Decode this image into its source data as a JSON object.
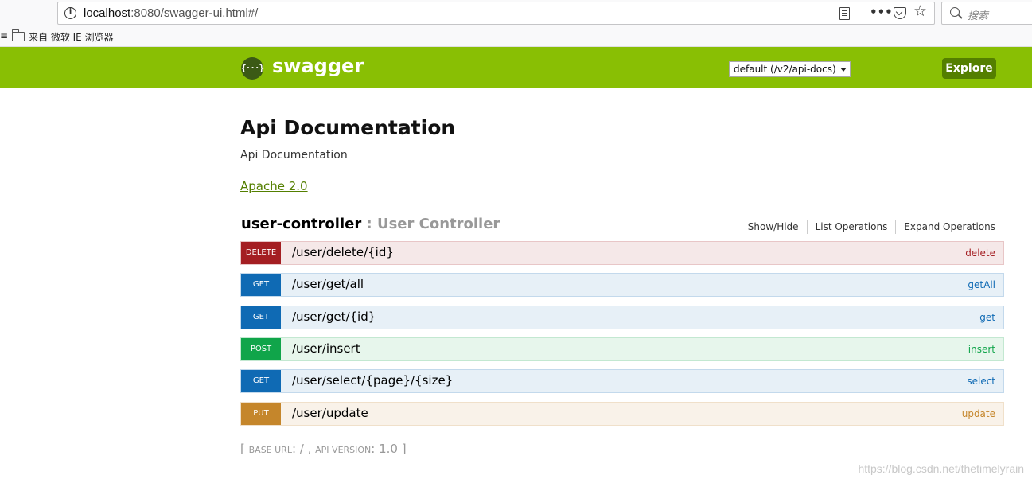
{
  "browser": {
    "url_host": "localhost",
    "url_rest": ":8080/swagger-ui.html#/",
    "search_placeholder": "搜索",
    "bookmark_edge": "≡",
    "bookmark_folder": "来自 微软 IE 浏览器",
    "info_glyph": "i",
    "more_glyph": "•••",
    "star_glyph": "☆"
  },
  "header": {
    "logo_glyph": "{···}",
    "brand": "swagger",
    "spec_select": "default (/v2/api-docs)",
    "explore_label": "Explore",
    "color": "#89bf04"
  },
  "info": {
    "title": "Api Documentation",
    "description": "Api Documentation",
    "license": "Apache 2.0"
  },
  "resource": {
    "name": "user-controller",
    "separator": " : ",
    "description": "User Controller",
    "actions": [
      "Show/Hide",
      "List Operations",
      "Expand Operations"
    ]
  },
  "endpoints": [
    {
      "method": "DELETE",
      "path": "/user/delete/{id}",
      "operation": "delete",
      "color": "#a41e22"
    },
    {
      "method": "GET",
      "path": "/user/get/all",
      "operation": "getAll",
      "color": "#0f6ab4"
    },
    {
      "method": "GET",
      "path": "/user/get/{id}",
      "operation": "get",
      "color": "#0f6ab4"
    },
    {
      "method": "POST",
      "path": "/user/insert",
      "operation": "insert",
      "color": "#10a54a"
    },
    {
      "method": "GET",
      "path": "/user/select/{page}/{size}",
      "operation": "select",
      "color": "#0f6ab4"
    },
    {
      "method": "PUT",
      "path": "/user/update",
      "operation": "update",
      "color": "#c5862b"
    }
  ],
  "footer": {
    "open": "[ ",
    "base_url_label": "BASE URL",
    "base_url_value": ": / , ",
    "api_version_label": "API VERSION",
    "api_version_value": ": 1.0 ",
    "close": "]"
  },
  "watermark": "https://blog.csdn.net/thetimelyrain"
}
